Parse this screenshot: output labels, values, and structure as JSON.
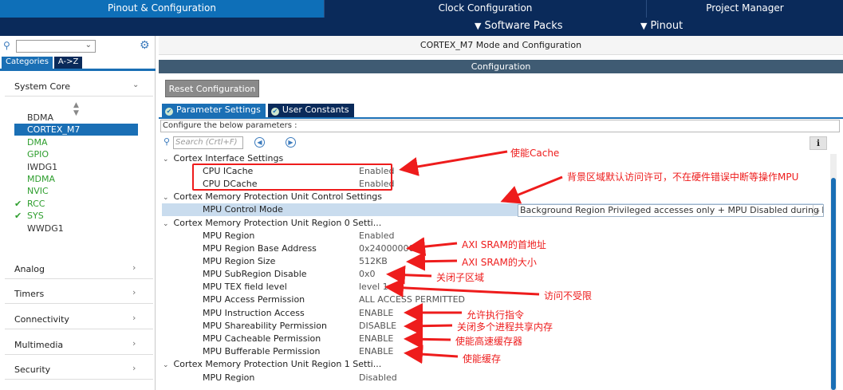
{
  "top_tabs": [
    "Pinout & Configuration",
    "Clock Configuration",
    "Project Manager"
  ],
  "sub_bar": {
    "software_packs": "Software Packs",
    "pinout": "Pinout"
  },
  "left": {
    "category_tabs": [
      "Categories",
      "A->Z"
    ],
    "system_core": "System Core",
    "peripherals": [
      {
        "name": "BDMA",
        "state": "normal"
      },
      {
        "name": "CORTEX_M7",
        "state": "selected"
      },
      {
        "name": "DMA",
        "state": "green"
      },
      {
        "name": "GPIO",
        "state": "green"
      },
      {
        "name": "IWDG1",
        "state": "normal"
      },
      {
        "name": "MDMA",
        "state": "green"
      },
      {
        "name": "NVIC",
        "state": "green"
      },
      {
        "name": "RCC",
        "state": "checked"
      },
      {
        "name": "SYS",
        "state": "checked"
      },
      {
        "name": "WWDG1",
        "state": "normal"
      }
    ],
    "groups": [
      "Analog",
      "Timers",
      "Connectivity",
      "Multimedia",
      "Security"
    ]
  },
  "right": {
    "mode_title": "CORTEX_M7 Mode and Configuration",
    "config_title": "Configuration",
    "reset_button": "Reset Configuration",
    "tabs": [
      "Parameter Settings",
      "User Constants"
    ],
    "configure_text": "Configure the below parameters :",
    "search_placeholder": "Search (Crtl+F)",
    "sections": {
      "cpu": "Cortex Interface Settings",
      "mpu_ctrl": "Cortex Memory Protection Unit Control Settings",
      "region0": "Cortex Memory Protection Unit Region 0 Setti...",
      "region1": "Cortex Memory Protection Unit Region 1 Setti..."
    },
    "cpu_params": [
      {
        "label": "CPU ICache",
        "value": "Enabled"
      },
      {
        "label": "CPU DCache",
        "value": "Enabled"
      }
    ],
    "mpu_control_mode": {
      "label": "MPU Control Mode",
      "value": "Background Region Privileged accesses only + MPU Disabled during hard fault, NMI and FAULTMASK handlers"
    },
    "region0_params": [
      {
        "label": "MPU Region",
        "value": "Enabled"
      },
      {
        "label": "MPU Region Base Address",
        "value": "0x24000000"
      },
      {
        "label": "MPU Region Size",
        "value": "512KB"
      },
      {
        "label": "MPU SubRegion Disable",
        "value": "0x0"
      },
      {
        "label": "MPU TEX field level",
        "value": "level 1"
      },
      {
        "label": "MPU Access Permission",
        "value": "ALL ACCESS PERMITTED"
      },
      {
        "label": "MPU Instruction Access",
        "value": "ENABLE"
      },
      {
        "label": "MPU Shareability Permission",
        "value": "DISABLE"
      },
      {
        "label": "MPU Cacheable Permission",
        "value": "ENABLE"
      },
      {
        "label": "MPU Bufferable  Permission",
        "value": "ENABLE"
      }
    ],
    "region1_params": [
      {
        "label": "MPU Region",
        "value": "Disabled"
      }
    ]
  },
  "annotations": {
    "cache": "使能Cache",
    "background": "背景区域默认访问许可，不在硬件错误中断等操作MPU",
    "base": "AXI SRAM的首地址",
    "size": "AXI SRAM的大小",
    "subregion": "关闭子区域",
    "access": "访问不受限",
    "instr": "允许执行指令",
    "share": "关闭多个进程共享内存",
    "cacheable": "使能高速缓存器",
    "buffer": "使能缓存"
  },
  "colors": {
    "accent": "#1a6fb5",
    "nav": "#0a2a5a",
    "annotation": "#ee1c1c"
  }
}
